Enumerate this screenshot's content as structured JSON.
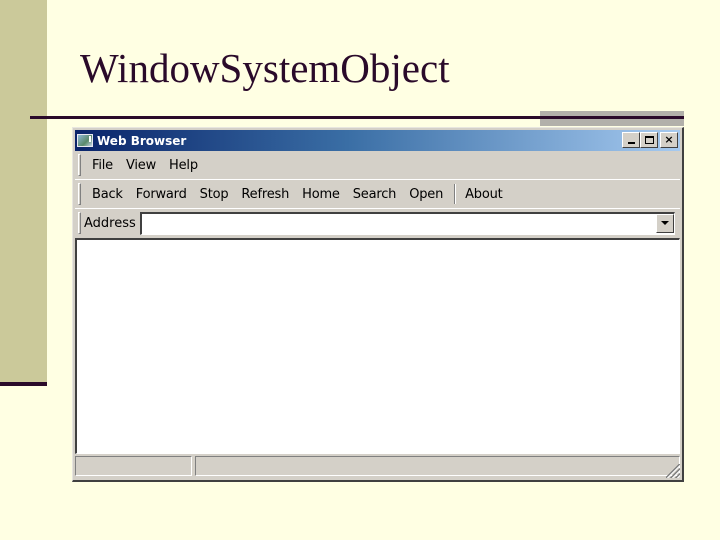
{
  "slide": {
    "title": "WindowSystemObject",
    "colors": {
      "background": "#ffffe3",
      "accent_bar": "#cbc99a",
      "rule": "#2a0a2a",
      "gray_block": "#b2b0aa"
    }
  },
  "window": {
    "title": "Web Browser",
    "icon": "app-window-icon",
    "controls": {
      "minimize": "minimize-icon",
      "maximize": "maximize-icon",
      "close": "×"
    },
    "menu": [
      {
        "label": "File"
      },
      {
        "label": "View"
      },
      {
        "label": "Help"
      }
    ],
    "toolbar": [
      {
        "label": "Back"
      },
      {
        "label": "Forward"
      },
      {
        "label": "Stop"
      },
      {
        "label": "Refresh"
      },
      {
        "label": "Home"
      },
      {
        "label": "Search"
      },
      {
        "label": "Open"
      },
      {
        "label": "About"
      }
    ],
    "address": {
      "label": "Address",
      "value": "",
      "dropdown_icon": "chevron-down-icon"
    },
    "statusbar": {
      "panel1": "",
      "panel2": ""
    },
    "colors": {
      "titlebar_start": "#0a246a",
      "titlebar_end": "#a6caf0",
      "face": "#d4d0c8"
    }
  }
}
